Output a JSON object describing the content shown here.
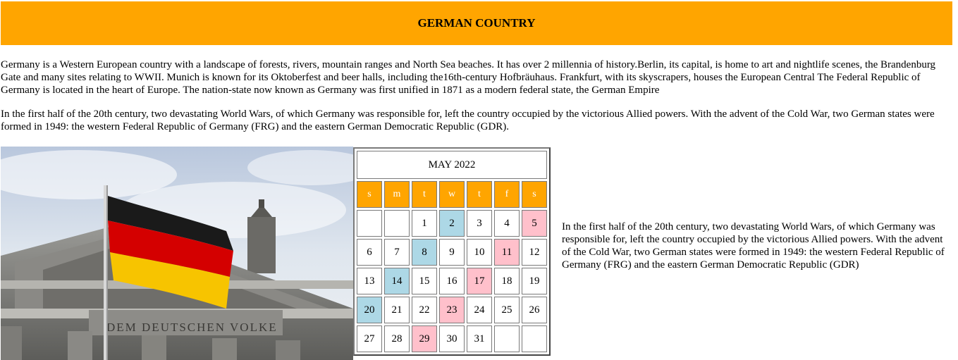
{
  "header": {
    "title": "GERMAN COUNTRY"
  },
  "paragraphs": [
    "Germany is a Western European country with a landscape of forests, rivers, mountain ranges and North Sea beaches. It has over 2 millennia of history.Berlin, its capital, is home to art and nightlife scenes, the Brandenburg Gate and many sites relating to WWII. Munich is known for its Oktoberfest and beer halls, including the16th-century Hofbräuhaus. Frankfurt, with its skyscrapers, houses the European Central The Federal Republic of Germany is located in the heart of Europe. The nation-state now known as Germany was first unified in 1871 as a modern federal state, the German Empire",
    "In the first half of the 20th century, two devastating World Wars, of which Germany was responsible for, left the country occupied by the victorious Allied powers. With the advent of the Cold War, two German states were formed in 1949: the western Federal Republic of Germany (FRG) and the eastern German Democratic Republic (GDR)."
  ],
  "image": {
    "inscription": "DEM DEUTSCHEN VOLKE"
  },
  "calendar": {
    "title": "MAY 2022",
    "weekdays": [
      "s",
      "m",
      "t",
      "w",
      "t",
      "f",
      "s"
    ],
    "weeks": [
      [
        "",
        "",
        "1",
        "2",
        "3",
        "4",
        "5"
      ],
      [
        "6",
        "7",
        "8",
        "9",
        "10",
        "11",
        "12"
      ],
      [
        "13",
        "14",
        "15",
        "16",
        "17",
        "18",
        "19"
      ],
      [
        "20",
        "21",
        "22",
        "23",
        "24",
        "25",
        "26"
      ],
      [
        "27",
        "28",
        "29",
        "30",
        "31",
        "",
        ""
      ]
    ],
    "blue_days": [
      "2",
      "8",
      "14",
      "20"
    ],
    "pink_days": [
      "5",
      "11",
      "17",
      "23",
      "29"
    ],
    "colors": {
      "weekday_header": "#ffa500",
      "blue": "#add8e6",
      "pink": "#ffc0cb"
    }
  },
  "side_text": "In the first half of the 20th century, two devastating World Wars, of which Germany was responsible for, left the country occupied by the victorious Allied powers. With the advent of the Cold War, two German states were formed in 1949: the western Federal Republic of Germany (FRG) and the eastern German Democratic Republic (GDR)"
}
